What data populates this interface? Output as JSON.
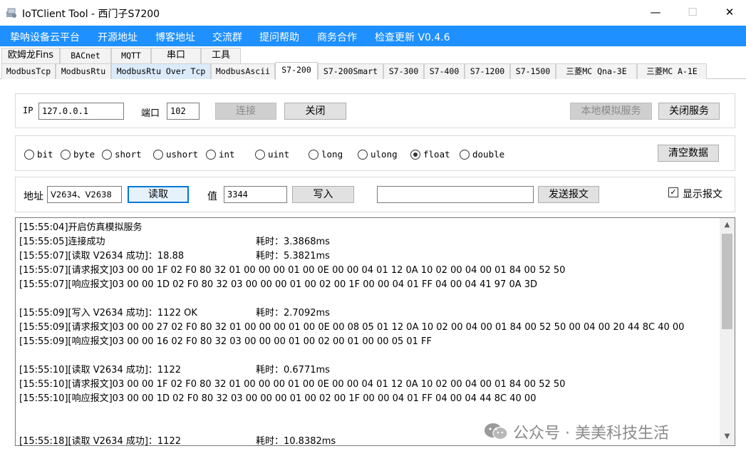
{
  "window": {
    "title": "IoTClient Tool - 西门子S7200",
    "minimize": "—",
    "maximize": "☐",
    "close": "✕"
  },
  "menu": [
    "挚呐设备云平台",
    "开源地址",
    "博客地址",
    "交流群",
    "提问帮助",
    "商务合作",
    "检查更新  V0.4.6"
  ],
  "tabs_row1": [
    "欧姆龙Fins",
    "BACnet",
    "MQTT",
    "串口",
    "工具"
  ],
  "tabs_row2": [
    "ModbusTcp",
    "ModbusRtu",
    "ModbusRtu Over Tcp",
    "ModbusAscii",
    "S7-200",
    "S7-200Smart",
    "S7-300",
    "S7-400",
    "S7-1200",
    "S7-1500",
    "三菱MC Qna-3E",
    "三菱MC A-1E"
  ],
  "connection": {
    "ip_label": "IP",
    "ip_value": "127.0.0.1",
    "port_label": "端口",
    "port_value": "102",
    "connect_label": "连接",
    "close_label": "关闭",
    "local_sim_label": "本地模拟服务",
    "stop_service_label": "关闭服务"
  },
  "datatypes": {
    "options": [
      "bit",
      "byte",
      "short",
      "ushort",
      "int",
      "uint",
      "long",
      "ulong",
      "float",
      "double"
    ],
    "selected": "float",
    "clear_label": "清空数据"
  },
  "readwrite": {
    "address_label": "地址",
    "address_value": "V2634、V2638",
    "read_label": "读取",
    "value_label": "值",
    "value_value": "3344",
    "write_label": "写入",
    "raw_value": "",
    "send_label": "发送报文",
    "show_packet_label": "显示报文",
    "show_packet_checked": true,
    "check_mark": "✓"
  },
  "log": {
    "lines": [
      {
        "text": "[15:55:04]开启仿真模拟服务",
        "time": ""
      },
      {
        "text": "[15:55:05]连接成功",
        "time": "耗时：3.3868ms"
      },
      {
        "text": "[15:55:07][读取 V2634 成功]：18.88",
        "time": "耗时：5.3821ms"
      },
      {
        "text": "[15:55:07][请求报文]03 00 00 1F 02 F0 80 32 01 00 00 00 01 00 0E 00 00 04 01 12 0A 10 02 00 04 00 01 84 00 52 50",
        "time": ""
      },
      {
        "text": "[15:55:07][响应报文]03 00 00 1D 02 F0 80 32 03 00 00 00 01 00 02 00 1F 00 00 04 01 FF 04 00 04 41 97 0A 3D",
        "time": ""
      },
      {
        "text": "",
        "time": ""
      },
      {
        "text": "[15:55:09][写入 V2634 成功]：1122 OK",
        "time": "耗时：2.7092ms"
      },
      {
        "text": "[15:55:09][请求报文]03 00 00 27 02 F0 80 32 01 00 00 00 01 00 0E 00 08 05 01 12 0A 10 02 00 04 00 01 84 00 52 50 00 04 00 20 44 8C 40 00",
        "time": ""
      },
      {
        "text": "[15:55:09][响应报文]03 00 00 16 02 F0 80 32 03 00 00 00 01 00 02 00 01 00 00 05 01 FF",
        "time": ""
      },
      {
        "text": "",
        "time": ""
      },
      {
        "text": "[15:55:10][读取 V2634 成功]：1122",
        "time": "耗时：0.6771ms"
      },
      {
        "text": "[15:55:10][请求报文]03 00 00 1F 02 F0 80 32 01 00 00 00 01 00 0E 00 00 04 01 12 0A 10 02 00 04 00 01 84 00 52 50",
        "time": ""
      },
      {
        "text": "[15:55:10][响应报文]03 00 00 1D 02 F0 80 32 03 00 00 00 01 00 02 00 1F 00 00 04 01 FF 04 00 04 44 8C 40 00",
        "time": ""
      },
      {
        "text": "",
        "time": ""
      },
      {
        "text": "",
        "time": ""
      },
      {
        "text": "[15:55:18][读取 V2634 成功]：1122",
        "time": "耗时：10.8382ms"
      }
    ]
  },
  "scroll": {
    "up": "▲",
    "down": "▼"
  },
  "watermark": "公众号 · 美美科技生活"
}
